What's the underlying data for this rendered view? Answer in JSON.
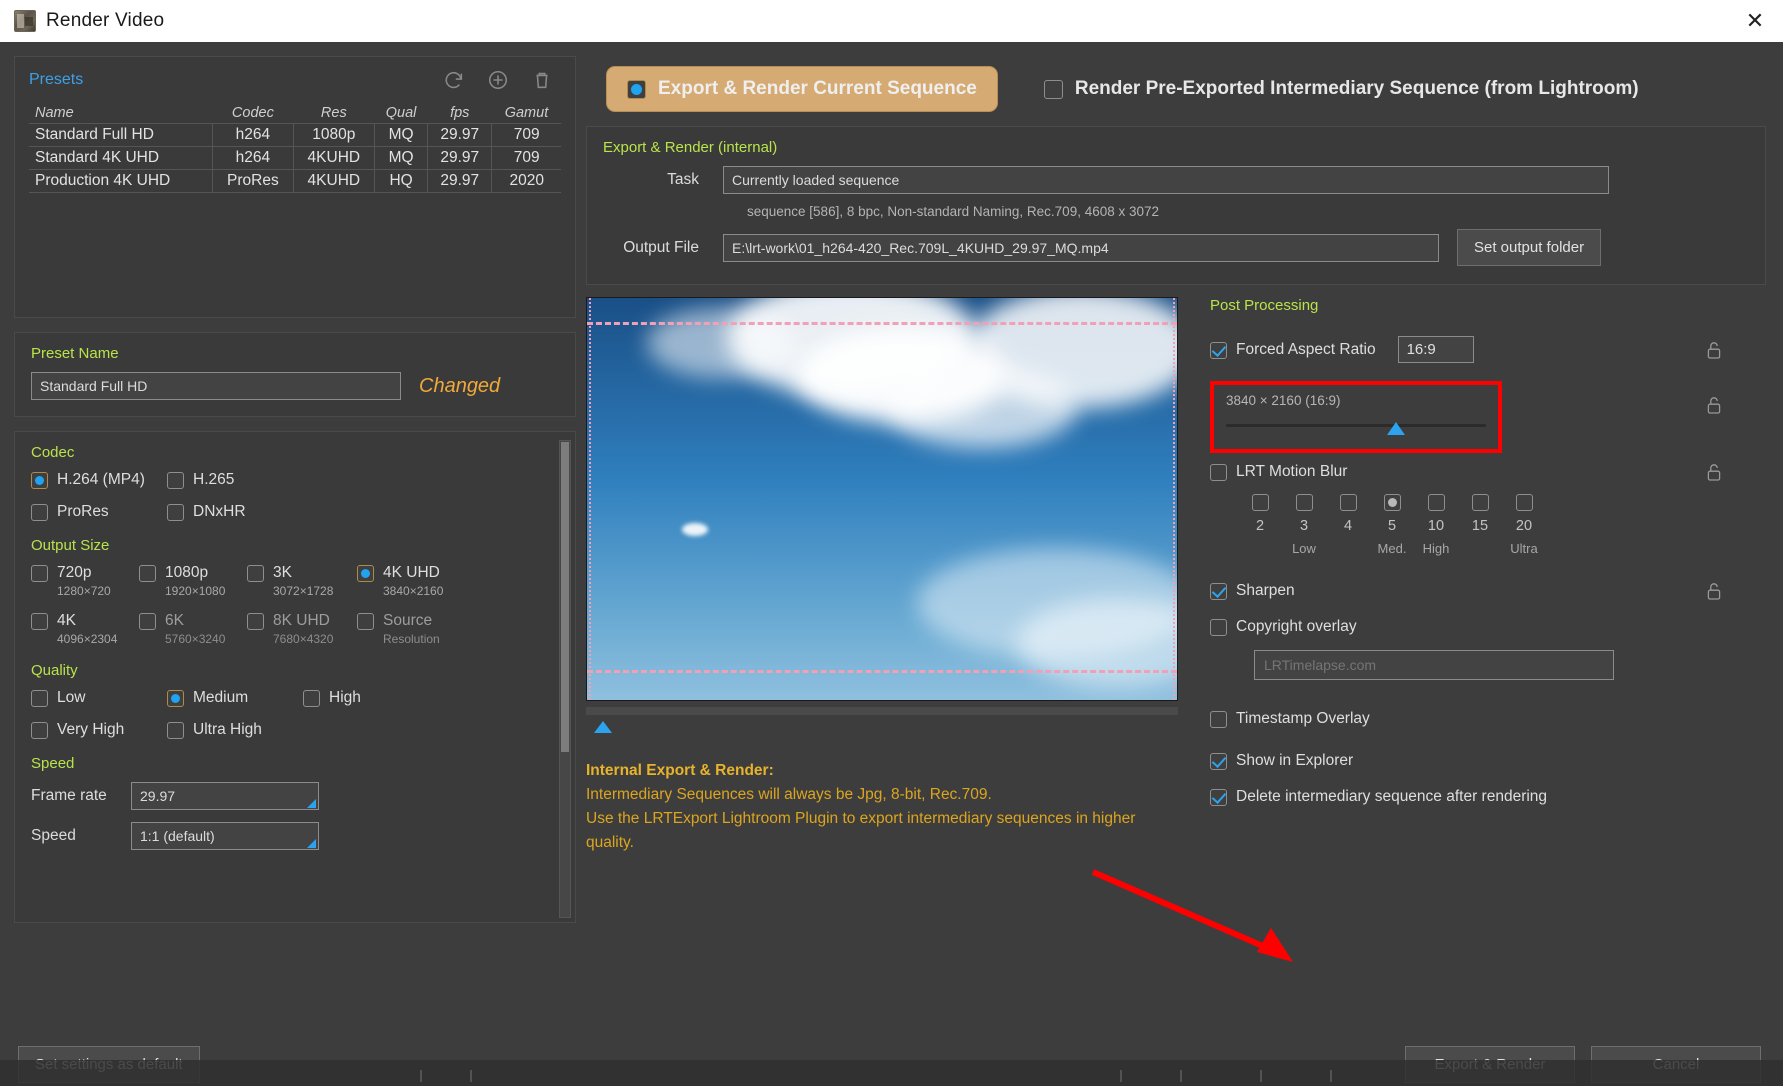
{
  "window": {
    "title": "Render Video",
    "close_label": "✕",
    "app_icon": "lrtimelapse-icon"
  },
  "presets": {
    "header": "Presets",
    "tools": [
      "refresh-icon",
      "add-icon",
      "delete-icon"
    ],
    "columns": [
      "Name",
      "Codec",
      "Res",
      "Qual",
      "fps",
      "Gamut"
    ],
    "rows": [
      {
        "name": "Standard Full HD",
        "codec": "h264",
        "res": "1080p",
        "qual": "MQ",
        "fps": "29.97",
        "gamut": "709"
      },
      {
        "name": "Standard 4K UHD",
        "codec": "h264",
        "res": "4KUHD",
        "qual": "MQ",
        "fps": "29.97",
        "gamut": "709"
      },
      {
        "name": "Production 4K UHD",
        "codec": "ProRes",
        "res": "4KUHD",
        "qual": "HQ",
        "fps": "29.97",
        "gamut": "2020"
      }
    ]
  },
  "preset_name": {
    "header": "Preset Name",
    "value": "Standard Full HD",
    "status": "Changed"
  },
  "codec": {
    "header": "Codec",
    "options": [
      {
        "label": "H.264 (MP4)",
        "selected": true
      },
      {
        "label": "H.265",
        "selected": false
      },
      {
        "label": "ProRes",
        "selected": false
      },
      {
        "label": "DNxHR",
        "selected": false
      }
    ]
  },
  "output_size": {
    "header": "Output Size",
    "options": [
      {
        "label": "720p",
        "sub": "1280×720",
        "selected": false,
        "dim": false
      },
      {
        "label": "1080p",
        "sub": "1920×1080",
        "selected": false,
        "dim": false
      },
      {
        "label": "3K",
        "sub": "3072×1728",
        "selected": false,
        "dim": false
      },
      {
        "label": "4K UHD",
        "sub": "3840×2160",
        "selected": true,
        "dim": false
      },
      {
        "label": "4K",
        "sub": "4096×2304",
        "selected": false,
        "dim": false
      },
      {
        "label": "6K",
        "sub": "5760×3240",
        "selected": false,
        "dim": true
      },
      {
        "label": "8K UHD",
        "sub": "7680×4320",
        "selected": false,
        "dim": true
      },
      {
        "label": "Source",
        "sub": "Resolution",
        "selected": false,
        "dim": true
      }
    ]
  },
  "quality": {
    "header": "Quality",
    "options": [
      {
        "label": "Low",
        "selected": false
      },
      {
        "label": "Medium",
        "selected": true
      },
      {
        "label": "High",
        "selected": false
      },
      {
        "label": "Very High",
        "selected": false
      },
      {
        "label": "Ultra High",
        "selected": false
      }
    ]
  },
  "speed": {
    "header": "Speed",
    "frame_rate_label": "Frame rate",
    "frame_rate_value": "29.97",
    "speed_label": "Speed",
    "speed_value": "1:1 (default)"
  },
  "footer": {
    "set_default": "Set settings as default",
    "export_render": "Export & Render",
    "cancel": "Cancel"
  },
  "mode": {
    "current_sequence": "Export & Render Current Sequence",
    "current_sequence_selected": true,
    "pre_exported": "Render Pre-Exported Intermediary Sequence (from Lightroom)",
    "pre_exported_selected": false
  },
  "export": {
    "header": "Export & Render (internal)",
    "task_label": "Task",
    "task_value": "Currently loaded sequence",
    "meta": "sequence [586], 8 bpc, Non-standard Naming, Rec.709, 4608 x 3072",
    "meta_italic": "Rec.709",
    "output_label": "Output File",
    "output_value": "E:\\lrt-work\\01_h264-420_Rec.709L_4KUHD_29.97_MQ.mp4",
    "set_folder": "Set output folder"
  },
  "notes": {
    "title": "Internal Export & Render:",
    "line1": "Intermediary Sequences will always be Jpg, 8-bit, Rec.709.",
    "line2": "Use the LRTExport Lightroom Plugin to export intermediary sequences in higher",
    "line3": "quality."
  },
  "post_processing": {
    "header": "Post Processing",
    "forced_aspect_ratio": {
      "label": "Forced Aspect Ratio",
      "checked": true,
      "value": "16:9"
    },
    "resolution_text": "3840 × 2160 (16:9)",
    "motion_blur": {
      "label": "LRT Motion Blur",
      "checked": false,
      "values": [
        "2",
        "3",
        "4",
        "5",
        "10",
        "15",
        "20"
      ],
      "selected_index": 3,
      "tags": [
        "",
        "Low",
        "",
        "Med.",
        "High",
        "",
        "Ultra"
      ]
    },
    "sharpen": {
      "label": "Sharpen",
      "checked": true
    },
    "copyright_overlay": {
      "label": "Copyright overlay",
      "checked": false,
      "placeholder": "LRTimelapse.com"
    },
    "timestamp_overlay": {
      "label": "Timestamp Overlay",
      "checked": false
    },
    "show_in_explorer": {
      "label": "Show in Explorer",
      "checked": true
    },
    "delete_intermediary": {
      "label": "Delete intermediary sequence after rendering",
      "checked": true
    }
  },
  "colors": {
    "accent_green": "#b9e34a",
    "accent_blue": "#3fa0e8",
    "checkbox_blue": "#21a3f0",
    "changed_orange": "#f0a93b",
    "notes_yellow": "#dca520",
    "pill_tan": "#d6aa73",
    "annotation_red": "#ff0000"
  }
}
